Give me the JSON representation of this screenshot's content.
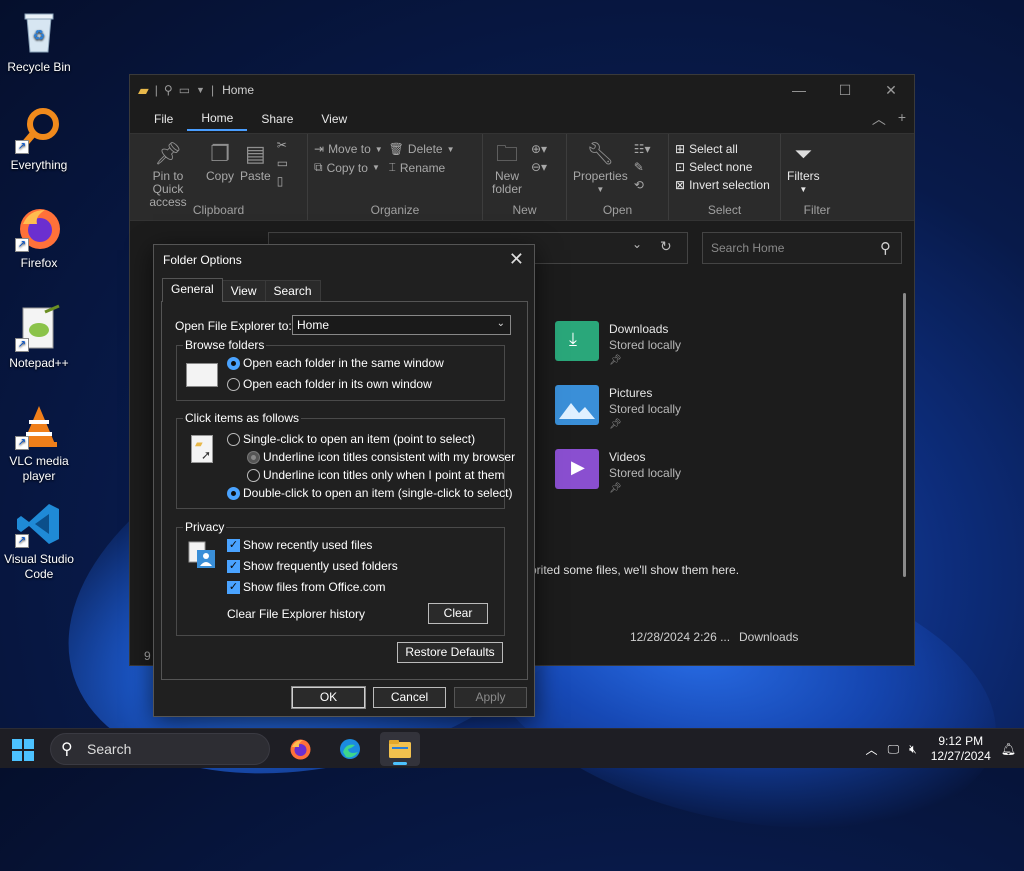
{
  "desktop": {
    "icons": [
      {
        "label": "Recycle Bin"
      },
      {
        "label": "Everything"
      },
      {
        "label": "Firefox"
      },
      {
        "label": "Notepad++"
      },
      {
        "label": "VLC media player"
      },
      {
        "label": "Visual Studio Code"
      }
    ]
  },
  "explorer": {
    "title": "Home",
    "tabs": [
      "File",
      "Home",
      "Share",
      "View"
    ],
    "active_tab": "Home",
    "ribbon": {
      "clipboard": {
        "pin": "Pin to Quick access",
        "copy": "Copy",
        "paste": "Paste",
        "group": "Clipboard"
      },
      "organize": {
        "move_to": "Move to",
        "copy_to": "Copy to",
        "delete": "Delete",
        "rename": "Rename",
        "group": "Organize"
      },
      "new": {
        "new_folder": "New folder",
        "group": "New"
      },
      "open": {
        "properties": "Properties",
        "group": "Open"
      },
      "select": {
        "select_all": "Select all",
        "select_none": "Select none",
        "invert": "Invert selection",
        "group": "Select"
      },
      "filter": {
        "filters": "Filters",
        "group": "Filter"
      }
    },
    "search_placeholder": "Search Home",
    "folders": [
      {
        "name": "Downloads",
        "status": "Stored locally",
        "color": "#2aa77a"
      },
      {
        "name": "Pictures",
        "status": "Stored locally",
        "color": "#3a8fd8"
      },
      {
        "name": "Videos",
        "status": "Stored locally",
        "color": "#8a4fd0"
      }
    ],
    "recent_message": "orited some files, we'll show them here.",
    "recent_date": "12/28/2024 2:26 ...",
    "recent_location": "Downloads",
    "status_count": "9"
  },
  "dialog": {
    "title": "Folder Options",
    "tabs": [
      "General",
      "View",
      "Search"
    ],
    "active_tab": "General",
    "open_to_label": "Open File Explorer to:",
    "open_to_value": "Home",
    "browse": {
      "legend": "Browse folders",
      "opt_same": "Open each folder in the same window",
      "opt_own": "Open each folder in its own window"
    },
    "click": {
      "legend": "Click items as follows",
      "single": "Single-click to open an item (point to select)",
      "underline_consistent": "Underline icon titles consistent with my browser",
      "underline_point": "Underline icon titles only when I point at them",
      "double": "Double-click to open an item (single-click to select)"
    },
    "privacy": {
      "legend": "Privacy",
      "recent": "Show recently used files",
      "frequent": "Show frequently used folders",
      "office": "Show files from Office.com",
      "clear_label": "Clear File Explorer history",
      "clear_btn": "Clear"
    },
    "restore": "Restore Defaults",
    "ok": "OK",
    "cancel": "Cancel",
    "apply": "Apply"
  },
  "taskbar": {
    "search": "Search",
    "time": "9:12 PM",
    "date": "12/27/2024"
  },
  "colors": {
    "accent": "#4aa3ff",
    "taskbar_accent": "#4cc2ff"
  }
}
